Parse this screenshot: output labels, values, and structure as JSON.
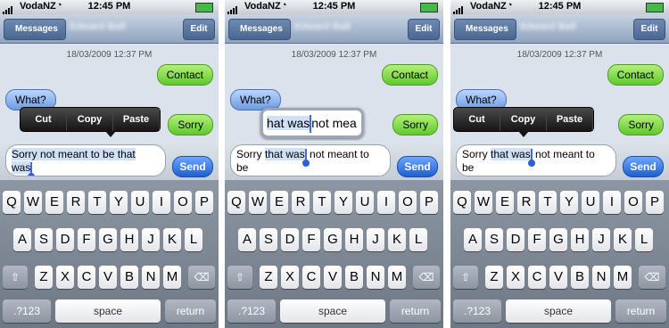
{
  "status": {
    "carrier": "VodaNZ",
    "time": "12:45 PM"
  },
  "nav": {
    "back": "Messages",
    "title": "Edward Ball",
    "edit": "Edit"
  },
  "thread": {
    "timestamp": "18/03/2009 12:37 PM",
    "out1": "Contact",
    "in1": "What?",
    "out2": "Sorry"
  },
  "menu": {
    "cut": "Cut",
    "copy": "Copy",
    "paste": "Paste"
  },
  "panel1": {
    "line1": "Sorry  not meant to be that",
    "line2": "was"
  },
  "panel2": {
    "magnifier": {
      "before": "hat was",
      "after": "not mea"
    },
    "field": {
      "before": "Sorry ",
      "sel": "that was",
      "after": " not meant to",
      "line2": "be"
    }
  },
  "panel3": {
    "field": {
      "before": "Sorry ",
      "sel": "that was",
      "after": " not meant to",
      "line2": "be"
    }
  },
  "send": "Send",
  "keyboard": {
    "row1": [
      "Q",
      "W",
      "E",
      "R",
      "T",
      "Y",
      "U",
      "I",
      "O",
      "P"
    ],
    "row2": [
      "A",
      "S",
      "D",
      "F",
      "G",
      "H",
      "J",
      "K",
      "L"
    ],
    "row3": [
      "Z",
      "X",
      "C",
      "V",
      "B",
      "N",
      "M"
    ],
    "shift": "⇧",
    "delete": "⌫",
    "numbers": ".?123",
    "space": "space",
    "return": "return"
  }
}
